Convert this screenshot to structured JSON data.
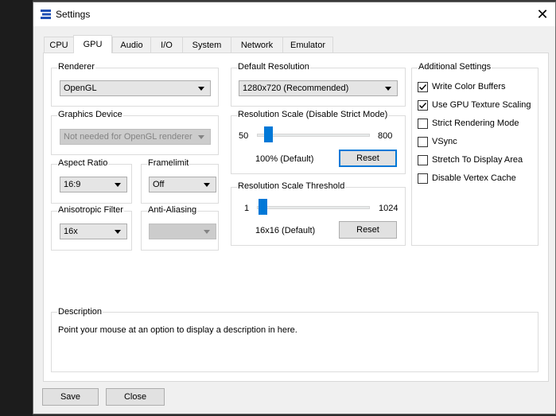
{
  "window": {
    "title": "Settings",
    "close_glyph": "✕"
  },
  "tabs": [
    {
      "label": "CPU"
    },
    {
      "label": "GPU"
    },
    {
      "label": "Audio"
    },
    {
      "label": "I/O"
    },
    {
      "label": "System"
    },
    {
      "label": "Network"
    },
    {
      "label": "Emulator"
    }
  ],
  "active_tab": "GPU",
  "renderer": {
    "label": "Renderer",
    "value": "OpenGL"
  },
  "graphics_device": {
    "label": "Graphics Device",
    "value": "Not needed for OpenGL renderer"
  },
  "aspect_ratio": {
    "label": "Aspect Ratio",
    "value": "16:9"
  },
  "framelimit": {
    "label": "Framelimit",
    "value": "Off"
  },
  "anisotropic": {
    "label": "Anisotropic Filter",
    "value": "16x"
  },
  "anti_aliasing": {
    "label": "Anti-Aliasing",
    "value": ""
  },
  "default_resolution": {
    "label": "Default Resolution",
    "value": "1280x720 (Recommended)"
  },
  "resolution_scale": {
    "label": "Resolution Scale (Disable Strict Mode)",
    "min": "50",
    "max": "800",
    "value_text": "100% (Default)",
    "reset": "Reset",
    "slider_fraction": 0.067
  },
  "resolution_threshold": {
    "label": "Resolution Scale Threshold",
    "min": "1",
    "max": "1024",
    "value_text": "16x16 (Default)",
    "reset": "Reset",
    "slider_fraction": 0.015
  },
  "additional": {
    "label": "Additional Settings",
    "items": [
      {
        "label": "Write Color Buffers",
        "checked": true
      },
      {
        "label": "Use GPU Texture Scaling",
        "checked": true
      },
      {
        "label": "Strict Rendering Mode",
        "checked": false
      },
      {
        "label": "VSync",
        "checked": false
      },
      {
        "label": "Stretch To Display Area",
        "checked": false
      },
      {
        "label": "Disable Vertex Cache",
        "checked": false
      }
    ]
  },
  "description": {
    "label": "Description",
    "text": "Point your mouse at an option to display a description in here."
  },
  "footer": {
    "save": "Save",
    "close": "Close"
  },
  "icons": {
    "app": "app-logo-icon",
    "close": "close-icon",
    "dropdown": "chevron-down-icon",
    "check": "checkmark-icon"
  }
}
